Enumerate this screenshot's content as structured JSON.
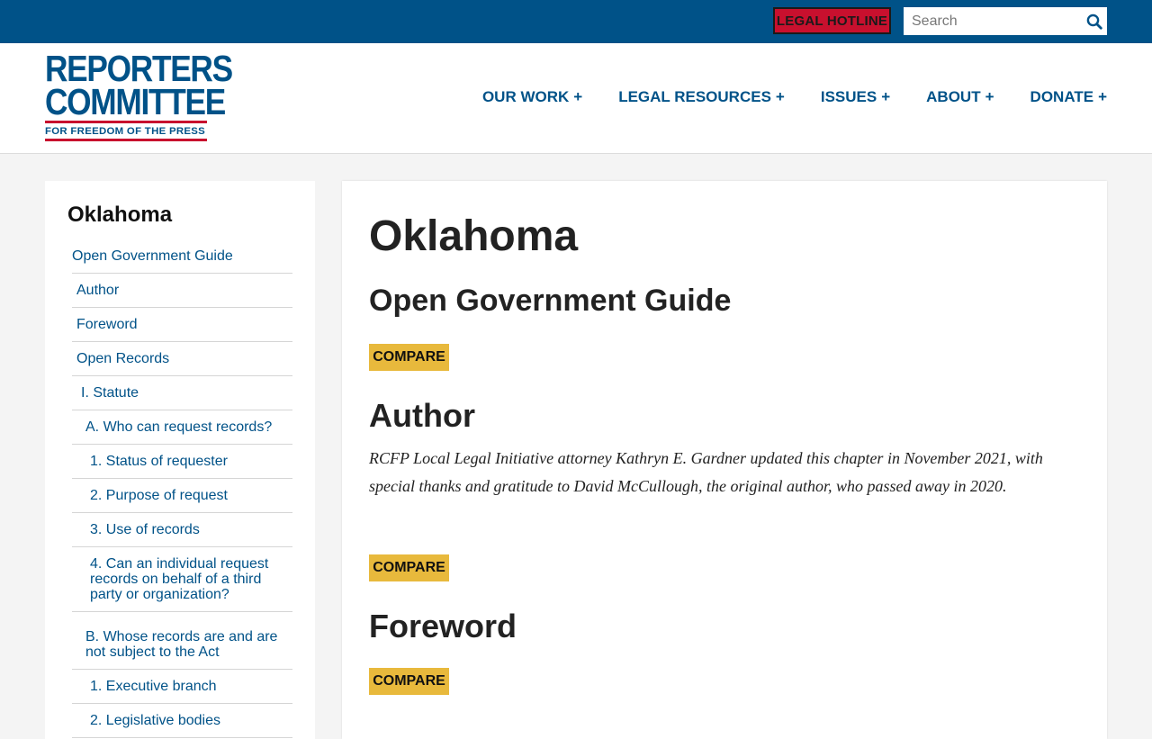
{
  "topbar": {
    "hotline_label": "LEGAL HOTLINE",
    "search_placeholder": "Search"
  },
  "logo": {
    "line1": "REPORTERS",
    "line2": "COMMITTEE",
    "tagline": "FOR FREEDOM OF THE PRESS"
  },
  "nav": {
    "items": [
      {
        "label": "OUR WORK",
        "plus": "+"
      },
      {
        "label": "LEGAL RESOURCES",
        "plus": "+"
      },
      {
        "label": "ISSUES",
        "plus": "+"
      },
      {
        "label": "ABOUT",
        "plus": "+"
      },
      {
        "label": "DONATE",
        "plus": "+"
      }
    ]
  },
  "sidebar": {
    "title": "Oklahoma",
    "items": [
      {
        "label": "Open Government Guide"
      },
      {
        "label": "Author"
      },
      {
        "label": "Foreword"
      },
      {
        "label": "Open Records"
      },
      {
        "label": "I. Statute"
      },
      {
        "label": "A. Who can request records?"
      },
      {
        "label": "1. Status of requester"
      },
      {
        "label": "2. Purpose of request"
      },
      {
        "label": "3. Use of records"
      },
      {
        "label": "4. Can an individual request records on behalf of a third party or organization?"
      },
      {
        "label": "B. Whose records are and are not subject to the Act"
      },
      {
        "label": "1. Executive branch"
      },
      {
        "label": "2. Legislative bodies"
      }
    ]
  },
  "main": {
    "title": "Oklahoma",
    "guide_heading": "Open Government Guide",
    "compare_label": "COMPARE",
    "author_heading": "Author",
    "author_text": "RCFP Local Legal Initiative attorney Kathryn E. Gardner updated this chapter in November 2021, with special thanks and gratitude to David McCullough, the original author, who passed away in 2020.",
    "foreword_heading": "Foreword"
  },
  "colors": {
    "brand_blue": "#005288",
    "hotline_red": "#c8102e",
    "compare_gold": "#e8b93c"
  }
}
